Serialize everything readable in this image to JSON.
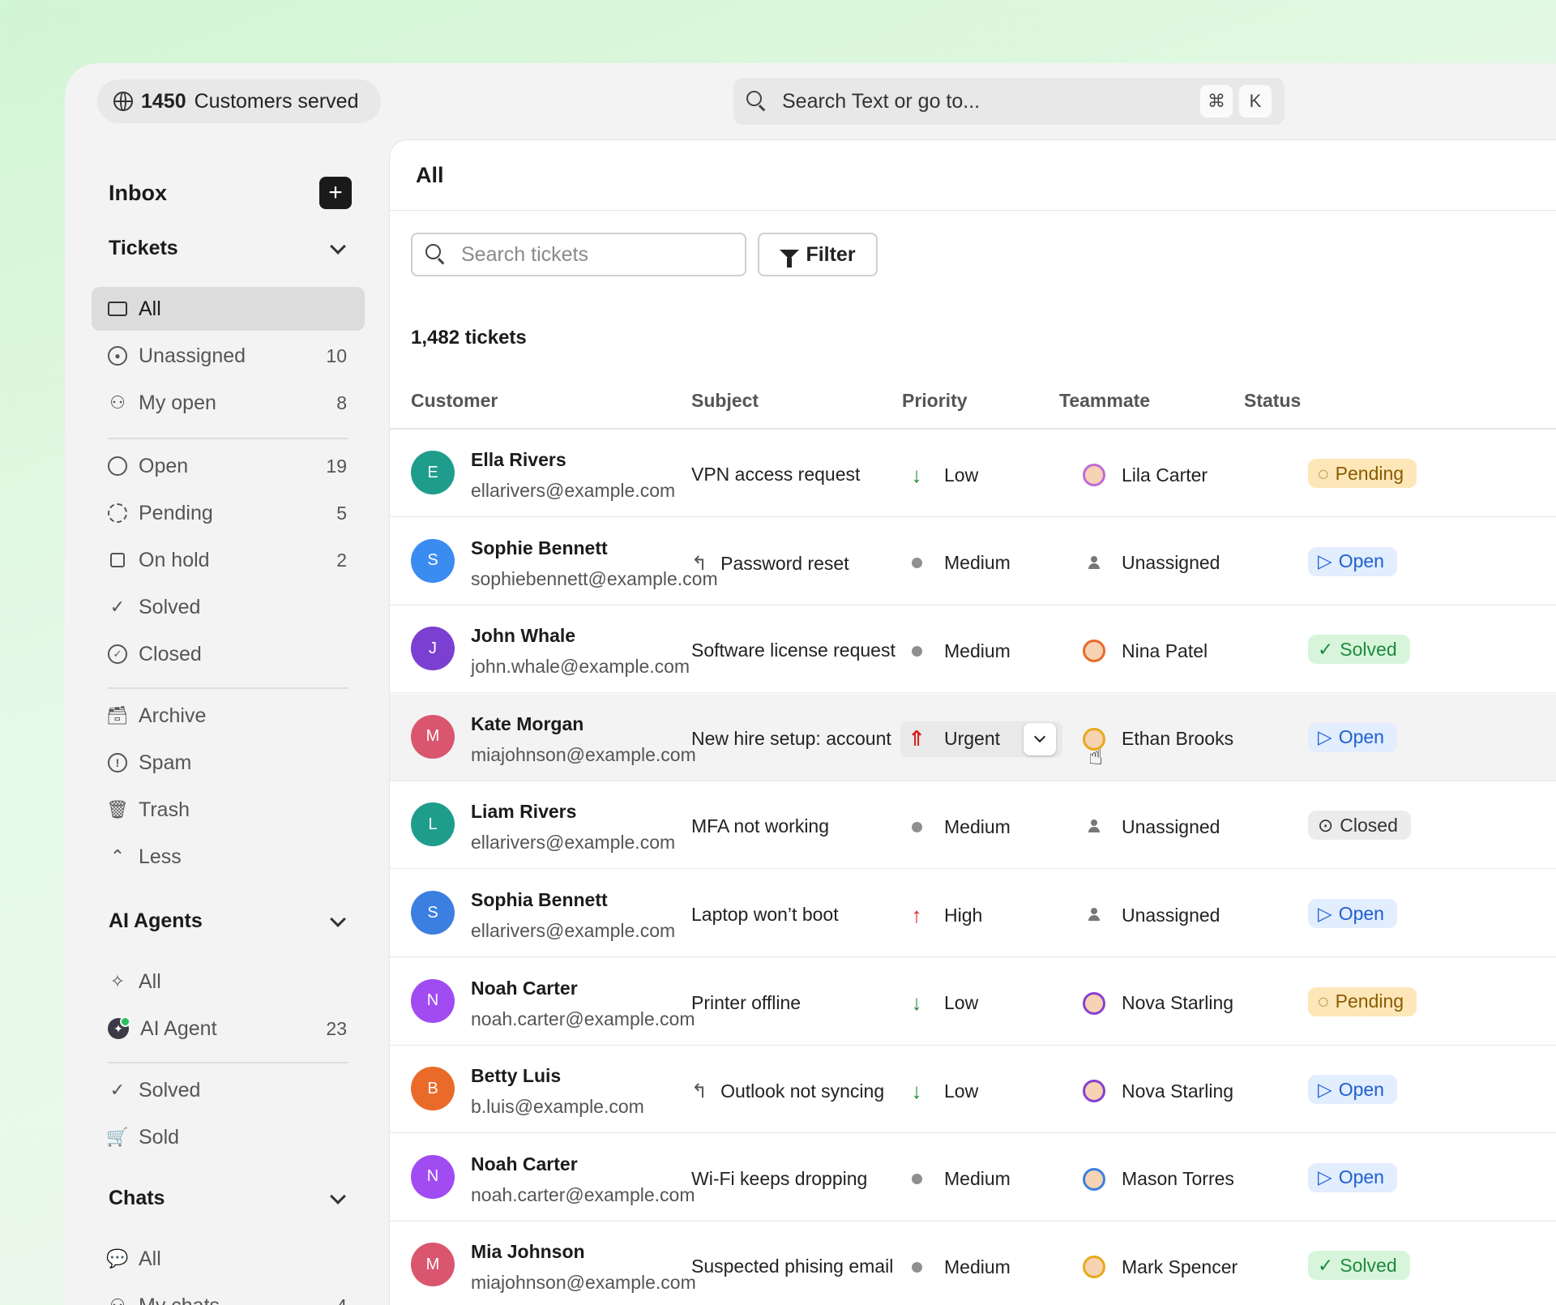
{
  "topbar": {
    "served_count": "1450",
    "served_label": "Customers served",
    "search_placeholder": "Search Text or go to...",
    "kbd_cmd": "⌘",
    "kbd_k": "K"
  },
  "sidebar": {
    "inbox_title": "Inbox",
    "tickets_title": "Tickets",
    "ticket_items": [
      {
        "label": "All",
        "count": ""
      },
      {
        "label": "Unassigned",
        "count": "10"
      },
      {
        "label": "My open",
        "count": "8"
      },
      {
        "label": "Open",
        "count": "19"
      },
      {
        "label": "Pending",
        "count": "5"
      },
      {
        "label": "On hold",
        "count": "2"
      },
      {
        "label": "Solved",
        "count": ""
      },
      {
        "label": "Closed",
        "count": ""
      },
      {
        "label": "Archive",
        "count": ""
      },
      {
        "label": "Spam",
        "count": ""
      },
      {
        "label": "Trash",
        "count": ""
      },
      {
        "label": "Less",
        "count": ""
      }
    ],
    "ai_title": "AI Agents",
    "ai_items": [
      {
        "label": "All",
        "count": ""
      },
      {
        "label": "AI Agent",
        "count": "23"
      },
      {
        "label": "Solved",
        "count": ""
      },
      {
        "label": "Sold",
        "count": ""
      }
    ],
    "chats_title": "Chats",
    "chat_items": [
      {
        "label": "All",
        "count": ""
      },
      {
        "label": "My chats",
        "count": "4"
      }
    ]
  },
  "main": {
    "title": "All",
    "search_placeholder": "Search tickets",
    "filter_label": "Filter",
    "ticket_count": "1,482 tickets",
    "columns": [
      "Customer",
      "Subject",
      "Priority",
      "Teammate",
      "Status"
    ],
    "rows": [
      {
        "initial": "E",
        "avatar_color": "#1f9d8c",
        "name": "Ella Rivers",
        "email": "ellarivers@example.com",
        "subject": "VPN access request",
        "reply": false,
        "priority": "Low",
        "teammate": "Lila Carter",
        "status": "Pending"
      },
      {
        "initial": "S",
        "avatar_color": "#3b8cf0",
        "name": "Sophie Bennett",
        "email": "sophiebennett@example.com",
        "subject": "Password reset",
        "reply": true,
        "priority": "Medium",
        "teammate": "Unassigned",
        "status": "Open"
      },
      {
        "initial": "J",
        "avatar_color": "#7b3fd1",
        "name": "John Whale",
        "email": "john.whale@example.com",
        "subject": "Software license request",
        "reply": false,
        "priority": "Medium",
        "teammate": "Nina Patel",
        "status": "Solved"
      },
      {
        "initial": "M",
        "avatar_color": "#d9566e",
        "name": "Kate Morgan",
        "email": "miajohnson@example.com",
        "subject": "New hire setup: account",
        "reply": false,
        "priority": "Urgent",
        "teammate": "Ethan Brooks",
        "status": "Open"
      },
      {
        "initial": "L",
        "avatar_color": "#1f9d8c",
        "name": "Liam Rivers",
        "email": "ellarivers@example.com",
        "subject": "MFA not working",
        "reply": false,
        "priority": "Medium",
        "teammate": "Unassigned",
        "status": "Closed"
      },
      {
        "initial": "S",
        "avatar_color": "#3b7fe0",
        "name": "Sophia Bennett",
        "email": "ellarivers@example.com",
        "subject": "Laptop won’t boot",
        "reply": false,
        "priority": "High",
        "teammate": "Unassigned",
        "status": "Open"
      },
      {
        "initial": "N",
        "avatar_color": "#a04cf2",
        "name": "Noah Carter",
        "email": "noah.carter@example.com",
        "subject": "Printer offline",
        "reply": false,
        "priority": "Low",
        "teammate": "Nova Starling",
        "status": "Pending"
      },
      {
        "initial": "B",
        "avatar_color": "#ea6a2a",
        "name": "Betty Luis",
        "email": "b.luis@example.com",
        "subject": "Outlook not syncing",
        "reply": true,
        "priority": "Low",
        "teammate": "Nova Starling",
        "status": "Open"
      },
      {
        "initial": "N",
        "avatar_color": "#a04cf2",
        "name": "Noah Carter",
        "email": "noah.carter@example.com",
        "subject": "Wi-Fi keeps dropping",
        "reply": false,
        "priority": "Medium",
        "teammate": "Mason Torres",
        "status": "Open"
      },
      {
        "initial": "M",
        "avatar_color": "#d9566e",
        "name": "Mia Johnson",
        "email": "miajohnson@example.com",
        "subject": "Suspected phising email",
        "reply": false,
        "priority": "Medium",
        "teammate": "Mark Spencer",
        "status": "Solved"
      }
    ]
  },
  "colors": {
    "low": "#1e8a3a",
    "high": "#d42020",
    "urgent": "#d42020",
    "accent": "#1b1b1b"
  }
}
